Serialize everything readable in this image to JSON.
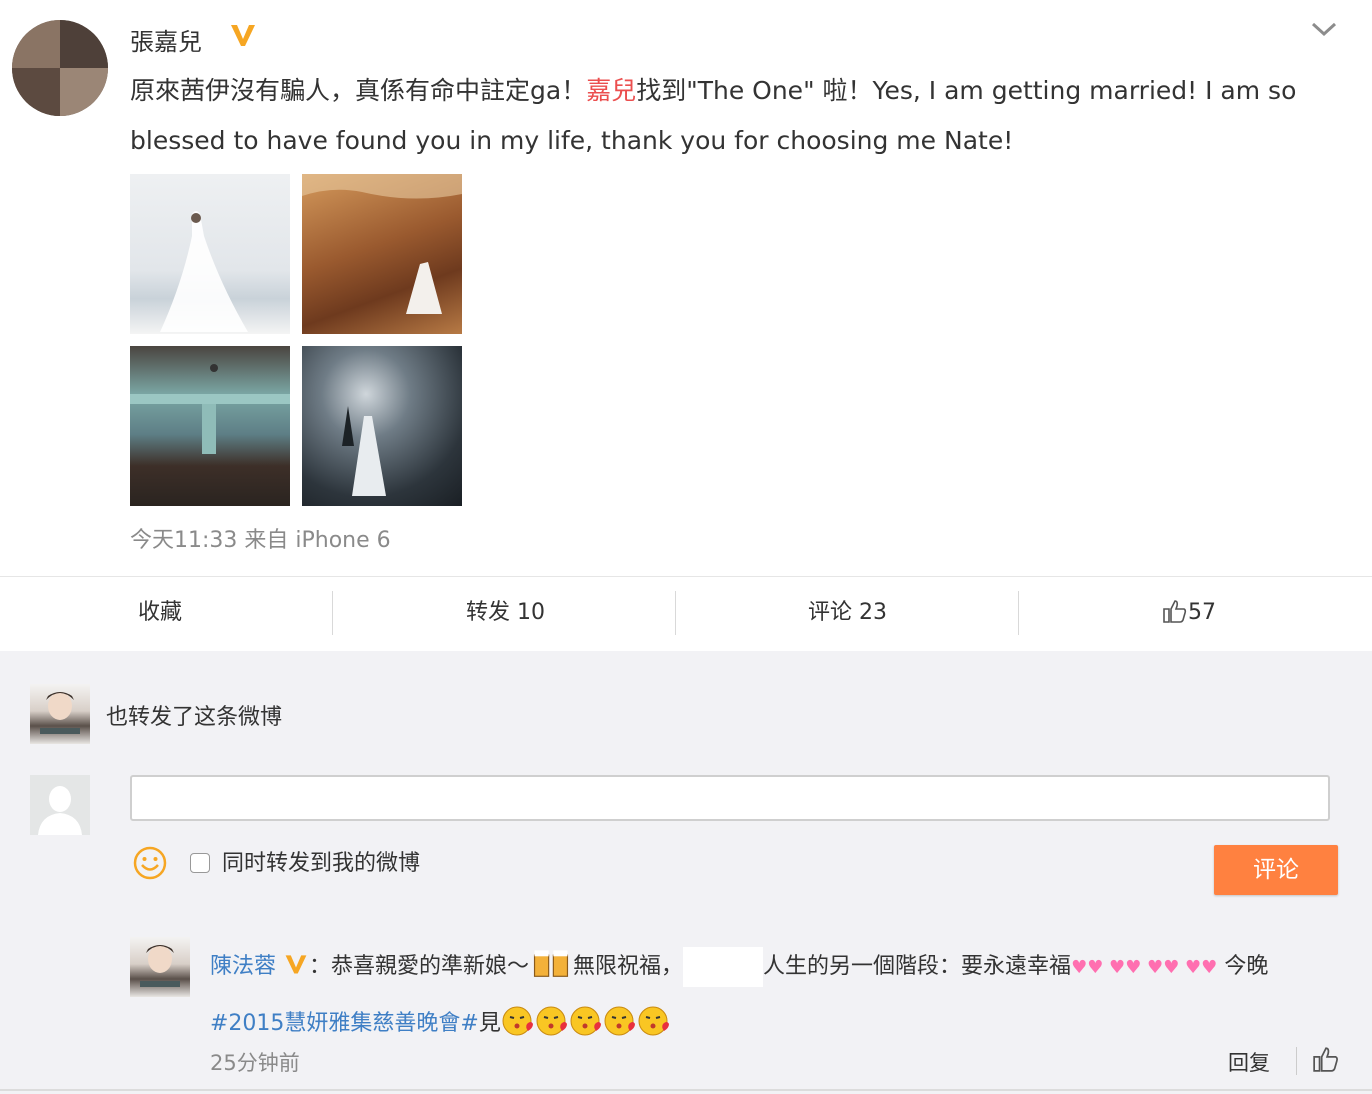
{
  "post": {
    "author": "張嘉兒",
    "text_before": "原來茜伊沒有騙人，真係有命中註定ga！",
    "mention": "嘉兒",
    "text_after": "找到\"The One\" 啦！Yes, I am getting married! I am so blessed to have found you in my life, thank you for choosing me Nate!",
    "meta": "今天11:33 来自 iPhone 6"
  },
  "actions": {
    "favorite": "收藏",
    "repost": "转发 10",
    "comment": "评论 23",
    "like_count": "57"
  },
  "repost_notice": "也转发了这条微博",
  "composer": {
    "input_value": "",
    "checkbox_label": "同时转发到我的微博",
    "submit": "评论"
  },
  "comment": {
    "name": "陳法蓉",
    "text_a": "：恭喜親愛的準新娘～",
    "text_b": "無限祝福，",
    "text_c": "人生的另一個階段：要永遠幸福",
    "text_d": "今晚",
    "hashtag": "#2015慧妍雅集慈善晚會#",
    "text_e": "見",
    "time": "25分钟前",
    "reply": "回复"
  },
  "colors": {
    "accent": "#ff8140",
    "link": "#3f7fc5",
    "mention": "#eb4f4f",
    "verified": "#f6a623"
  }
}
